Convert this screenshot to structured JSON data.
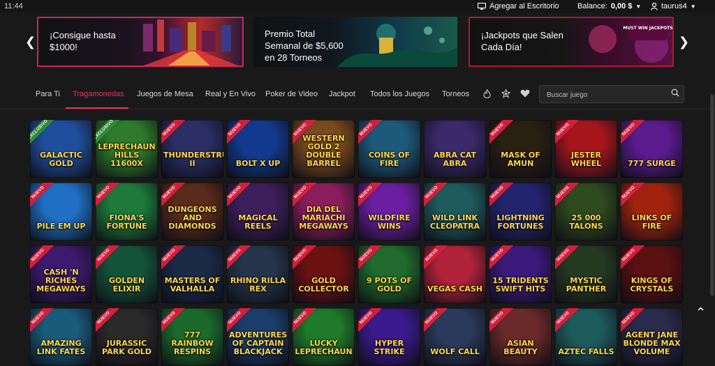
{
  "status_bar": {
    "time": "11:44"
  },
  "header": {
    "add_desktop": "Agregar al Escritorio",
    "balance_label": "Balance:",
    "balance_value": "0,00 $",
    "username": "taurus4"
  },
  "banners": [
    {
      "text": "¡Consigue hasta $1000!"
    },
    {
      "text": "Premio Total Semanal de $5,600 en 28 Torneos"
    },
    {
      "text": "¡Jackpots que Salen Cada Día!",
      "art_text": "MUST WIN JACKPOTS"
    }
  ],
  "nav": {
    "tabs": [
      "Para Ti",
      "Tragamonedas",
      "Juegos de Mesa",
      "Real y En Vivo",
      "Poker de Video",
      "Jackpot",
      "Todos los Juegos",
      "Torneos"
    ],
    "active_tab": "Tragamonedas",
    "search_placeholder": "Buscar juego"
  },
  "badges": {
    "exclusive": "EXCLUSIVO",
    "new": "NUEVO"
  },
  "games": [
    {
      "name": "Galactic Gold",
      "badge": "exclusive",
      "color": "#1f4f9c"
    },
    {
      "name": "Leprechaun Hills 11600X",
      "badge": "exclusive",
      "color": "#2d7b2b"
    },
    {
      "name": "Thunderstruck II",
      "badge": "new",
      "color": "#2b2f66"
    },
    {
      "name": "Bolt X Up",
      "badge": "new",
      "color": "#123a8c"
    },
    {
      "name": "Western Gold 2 Double Barrel",
      "badge": "new",
      "color": "#7a4a1e"
    },
    {
      "name": "Coins of Fire",
      "badge": "new",
      "color": "#1d5a7a"
    },
    {
      "name": "Abra Cat Abra",
      "badge": "",
      "color": "#3a2a6a"
    },
    {
      "name": "Mask of Amun",
      "badge": "new",
      "color": "#2a2012"
    },
    {
      "name": "Jester Wheel",
      "badge": "new",
      "color": "#a4161c"
    },
    {
      "name": "777 Surge",
      "badge": "new",
      "color": "#5a1b8c"
    },
    {
      "name": "Pile Em Up",
      "badge": "new",
      "color": "#1f6fc4"
    },
    {
      "name": "Fiona's Fortune",
      "badge": "new",
      "color": "#1d7a3a"
    },
    {
      "name": "Dungeons and Diamonds",
      "badge": "new",
      "color": "#5a2a1a"
    },
    {
      "name": "Magical Reels",
      "badge": "new",
      "color": "#3d1f5c"
    },
    {
      "name": "Dia del Mariachi Megaways",
      "badge": "new",
      "color": "#8a1e5c"
    },
    {
      "name": "Wildfire Wins",
      "badge": "new",
      "color": "#6a1fa0"
    },
    {
      "name": "Wild Link Cleopatra",
      "badge": "new",
      "color": "#1e5a5c"
    },
    {
      "name": "Lightning Fortunes",
      "badge": "new",
      "color": "#23246e"
    },
    {
      "name": "25 000 Talons",
      "badge": "new",
      "color": "#2e4a1f"
    },
    {
      "name": "Links of Fire",
      "badge": "new",
      "color": "#a1230e"
    },
    {
      "name": "Cash 'N Riches Megaways",
      "badge": "new",
      "color": "#3d1a6e"
    },
    {
      "name": "Golden Elixir",
      "badge": "new",
      "color": "#14533a"
    },
    {
      "name": "Masters of Valhalla",
      "badge": "new",
      "color": "#1b2a45"
    },
    {
      "name": "Rhino Rilla Rex",
      "badge": "new",
      "color": "#25344a"
    },
    {
      "name": "Gold Collector",
      "badge": "new",
      "color": "#6b1111"
    },
    {
      "name": "9 Pots of Gold",
      "badge": "new",
      "color": "#1f6a2c"
    },
    {
      "name": "Vegas Cash",
      "badge": "new",
      "color": "#b0233a"
    },
    {
      "name": "15 Tridents Swift Hits",
      "badge": "new",
      "color": "#3a1a7a"
    },
    {
      "name": "Mystic Panther",
      "badge": "new",
      "color": "#263a22"
    },
    {
      "name": "Kings of Crystals",
      "badge": "new",
      "color": "#5a1010"
    },
    {
      "name": "Amazing Link Fates",
      "badge": "new",
      "color": "#1a5a7a"
    },
    {
      "name": "Jurassic Park Gold",
      "badge": "new",
      "color": "#2a2a2a"
    },
    {
      "name": "777 Rainbow Respins",
      "badge": "new",
      "color": "#1b6a2c"
    },
    {
      "name": "Adventures of Captain Blackjack",
      "badge": "new",
      "color": "#1a3d6a"
    },
    {
      "name": "Lucky Leprechaun",
      "badge": "new",
      "color": "#1e7a2a"
    },
    {
      "name": "Hyper Strike",
      "badge": "new",
      "color": "#3a1a8c"
    },
    {
      "name": "Wolf Call",
      "badge": "new",
      "color": "#2a3a5a"
    },
    {
      "name": "Asian Beauty",
      "badge": "new",
      "color": "#6a2a2a"
    },
    {
      "name": "Aztec Falls",
      "badge": "new",
      "color": "#1d5a5a"
    },
    {
      "name": "Agent Jane Blonde Max Volume",
      "badge": "new",
      "color": "#2a2a4a"
    }
  ]
}
